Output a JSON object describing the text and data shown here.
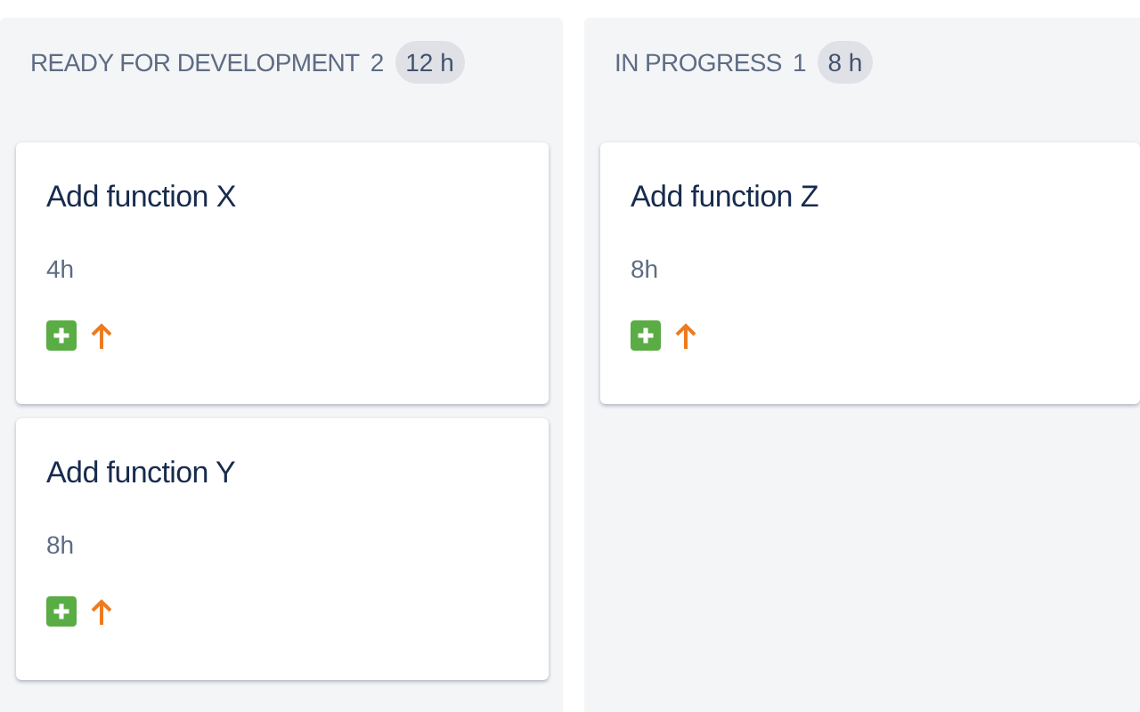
{
  "columns": [
    {
      "title": "READY FOR DEVELOPMENT",
      "count": "2",
      "estimate": "12 h",
      "cards": [
        {
          "title": "Add function X",
          "estimate": "4h"
        },
        {
          "title": "Add function Y",
          "estimate": "8h"
        }
      ]
    },
    {
      "title": "IN PROGRESS",
      "count": "1",
      "estimate": "8 h",
      "cards": [
        {
          "title": "Add function Z",
          "estimate": "8h"
        }
      ]
    }
  ]
}
